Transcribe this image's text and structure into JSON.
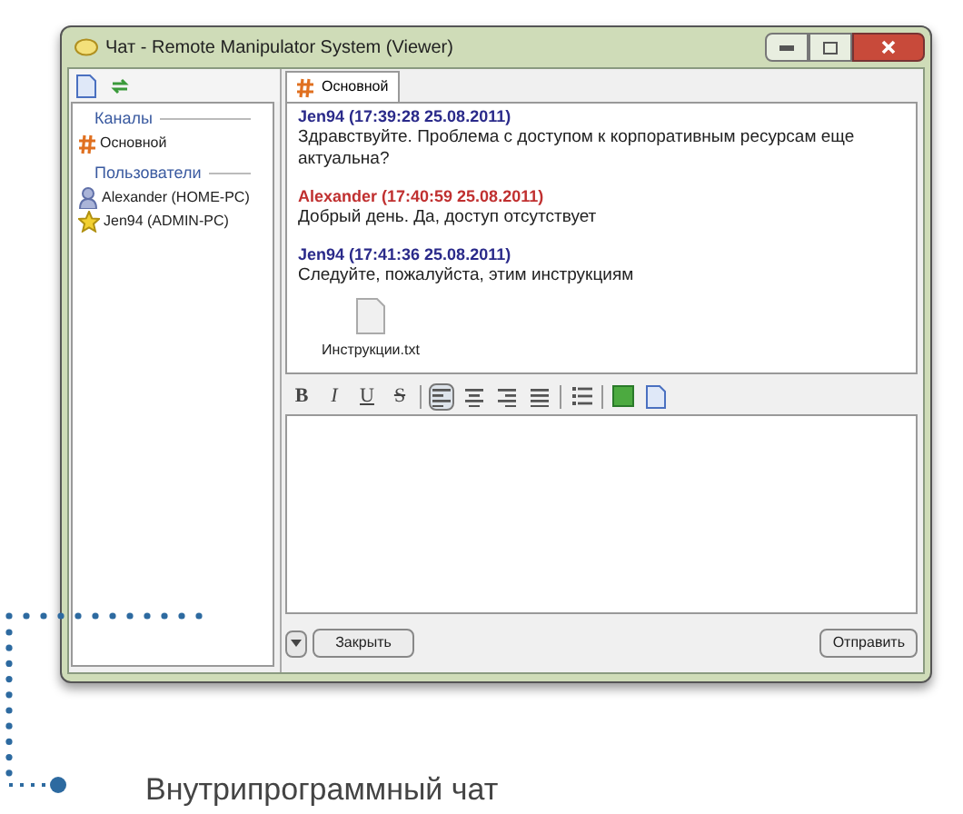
{
  "window": {
    "title": "Чат - Remote Manipulator System (Viewer)"
  },
  "sidebar": {
    "sections": [
      {
        "title": "Каналы",
        "items": [
          {
            "kind": "channel",
            "label": "Основной"
          }
        ]
      },
      {
        "title": "Пользователи",
        "items": [
          {
            "kind": "user",
            "label": "Alexander (HOME-PC)"
          },
          {
            "kind": "admin",
            "label": "Jen94 (ADMIN-PC)"
          }
        ]
      }
    ]
  },
  "tabs": [
    {
      "label": "Основной",
      "selected": true
    }
  ],
  "messages": [
    {
      "author": "Jen94 (17:39:28 25.08.2011)",
      "color": "#2a2a8a",
      "text": "Здравствуйте. Проблема с доступом к корпоративным ресурсам еще актуальна?"
    },
    {
      "author": "Alexander (17:40:59 25.08.2011)",
      "color": "#c03030",
      "text": "Добрый день. Да, доступ отсутствует"
    },
    {
      "author": "Jen94 (17:41:36 25.08.2011)",
      "color": "#2a2a8a",
      "text": "Следуйте, пожалуйста, этим инструкциям",
      "attachment": "Инструкции.txt"
    }
  ],
  "toolbar": [
    {
      "kind": "bold",
      "label": "B",
      "selected": false
    },
    {
      "kind": "italic",
      "label": "I",
      "selected": false
    },
    {
      "kind": "underline",
      "label": "U",
      "selected": false
    },
    {
      "kind": "strike",
      "label": "S",
      "selected": false
    },
    {
      "kind": "align-left",
      "selected": true
    },
    {
      "kind": "align-center",
      "selected": false
    },
    {
      "kind": "align-right",
      "selected": false
    },
    {
      "kind": "justify",
      "selected": false
    },
    {
      "kind": "list",
      "selected": false
    },
    {
      "kind": "image",
      "selected": false
    },
    {
      "kind": "file",
      "selected": false
    }
  ],
  "buttons": {
    "close": "Закрыть",
    "send": "Отправить"
  },
  "caption": "Внутрипрограммный чат"
}
